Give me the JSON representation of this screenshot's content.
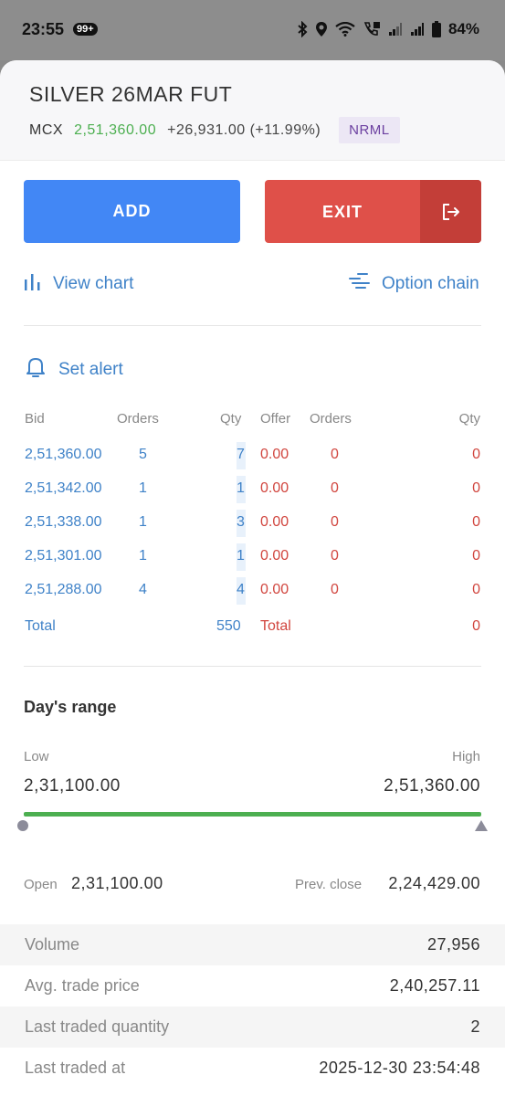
{
  "status_bar": {
    "time": "23:55",
    "badge": "99+",
    "battery": "84%"
  },
  "instrument": {
    "name": "SILVER 26MAR FUT",
    "exchange": "MCX",
    "ltp": "2,51,360.00",
    "change": "+26,931.00 (+11.99%)",
    "product": "NRML"
  },
  "actions": {
    "add_label": "ADD",
    "exit_label": "EXIT"
  },
  "links": {
    "view_chart": "View chart",
    "option_chain": "Option chain",
    "set_alert": "Set alert"
  },
  "market_depth": {
    "headers": {
      "bid": "Bid",
      "orders": "Orders",
      "qty": "Qty",
      "offer": "Offer",
      "offer_orders": "Orders",
      "offer_qty": "Qty"
    },
    "rows": [
      {
        "bid": "2,51,360.00",
        "bid_orders": "5",
        "bid_qty": "7",
        "offer": "0.00",
        "offer_orders": "0",
        "offer_qty": "0"
      },
      {
        "bid": "2,51,342.00",
        "bid_orders": "1",
        "bid_qty": "1",
        "offer": "0.00",
        "offer_orders": "0",
        "offer_qty": "0"
      },
      {
        "bid": "2,51,338.00",
        "bid_orders": "1",
        "bid_qty": "3",
        "offer": "0.00",
        "offer_orders": "0",
        "offer_qty": "0"
      },
      {
        "bid": "2,51,301.00",
        "bid_orders": "1",
        "bid_qty": "1",
        "offer": "0.00",
        "offer_orders": "0",
        "offer_qty": "0"
      },
      {
        "bid": "2,51,288.00",
        "bid_orders": "4",
        "bid_qty": "4",
        "offer": "0.00",
        "offer_orders": "0",
        "offer_qty": "0"
      }
    ],
    "total_label": "Total",
    "bid_total": "550",
    "offer_total_label": "Total",
    "offer_total": "0"
  },
  "days_range": {
    "title": "Day's range",
    "low_label": "Low",
    "high_label": "High",
    "low": "2,31,100.00",
    "high": "2,51,360.00"
  },
  "ohlc": {
    "open_label": "Open",
    "open": "2,31,100.00",
    "prev_close_label": "Prev. close",
    "prev_close": "2,24,429.00"
  },
  "stats": [
    {
      "label": "Volume",
      "value": "27,956"
    },
    {
      "label": "Avg. trade price",
      "value": "2,40,257.11"
    },
    {
      "label": "Last traded quantity",
      "value": "2"
    },
    {
      "label": "Last traded at",
      "value": "2025-12-30 23:54:48"
    }
  ],
  "colors": {
    "accent_blue": "#4287f5",
    "exit_red": "#df5049",
    "positive_green": "#4caf50",
    "bid_blue": "#3f82c8",
    "offer_red": "#d1463f"
  }
}
